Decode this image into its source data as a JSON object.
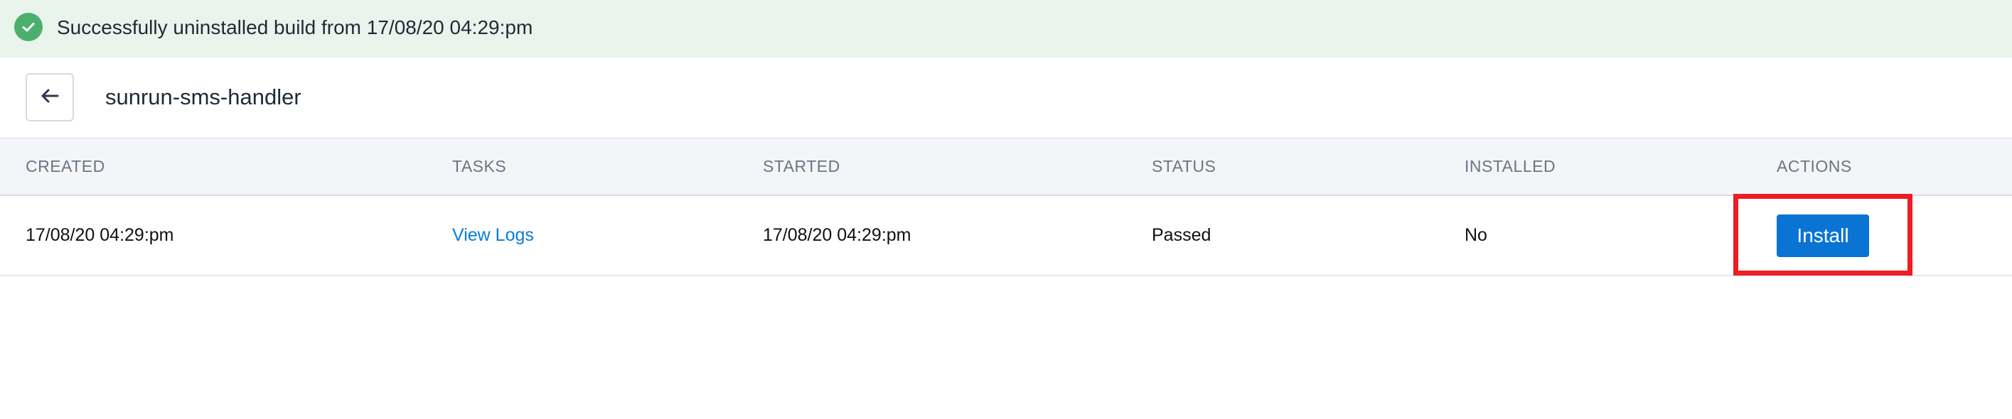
{
  "banner": {
    "message": "Successfully uninstalled build from 17/08/20 04:29:pm",
    "icon": "check-circle-icon",
    "color": "#4caf6e",
    "background": "#e8f4ec"
  },
  "header": {
    "back_icon": "arrow-left-icon",
    "title": "sunrun-sms-handler"
  },
  "table": {
    "columns": [
      "CREATED",
      "TASKS",
      "STARTED",
      "STATUS",
      "INSTALLED",
      "ACTIONS"
    ],
    "rows": [
      {
        "created": "17/08/20 04:29:pm",
        "tasks": "View Logs",
        "started": "17/08/20 04:29:pm",
        "status": "Passed",
        "installed": "No",
        "action": "Install"
      }
    ]
  },
  "colors": {
    "accent": "#0a74d4",
    "link": "#0a7bd6",
    "highlight": "#ee1c24"
  }
}
